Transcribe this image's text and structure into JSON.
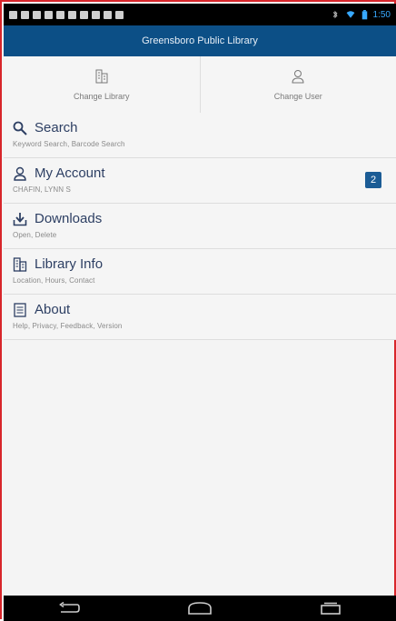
{
  "status_bar": {
    "time": "1:50"
  },
  "header": {
    "title": "Greensboro Public Library"
  },
  "top_actions": [
    {
      "label": "Change Library",
      "icon": "library-building-icon"
    },
    {
      "label": "Change User",
      "icon": "user-icon"
    }
  ],
  "menu": [
    {
      "title": "Search",
      "subtitle": "Keyword Search, Barcode Search",
      "icon": "search-icon"
    },
    {
      "title": "My Account",
      "subtitle": "CHAFIN, LYNN S",
      "icon": "user-icon",
      "badge": "2"
    },
    {
      "title": "Downloads",
      "subtitle": "Open, Delete",
      "icon": "download-icon"
    },
    {
      "title": "Library Info",
      "subtitle": "Location, Hours, Contact",
      "icon": "library-building-icon"
    },
    {
      "title": "About",
      "subtitle": "Help, Privacy, Feedback, Version",
      "icon": "info-document-icon"
    }
  ],
  "colors": {
    "header_bg": "#0c4f86",
    "badge_bg": "#1b5c95",
    "menu_title": "#2d3f63"
  }
}
